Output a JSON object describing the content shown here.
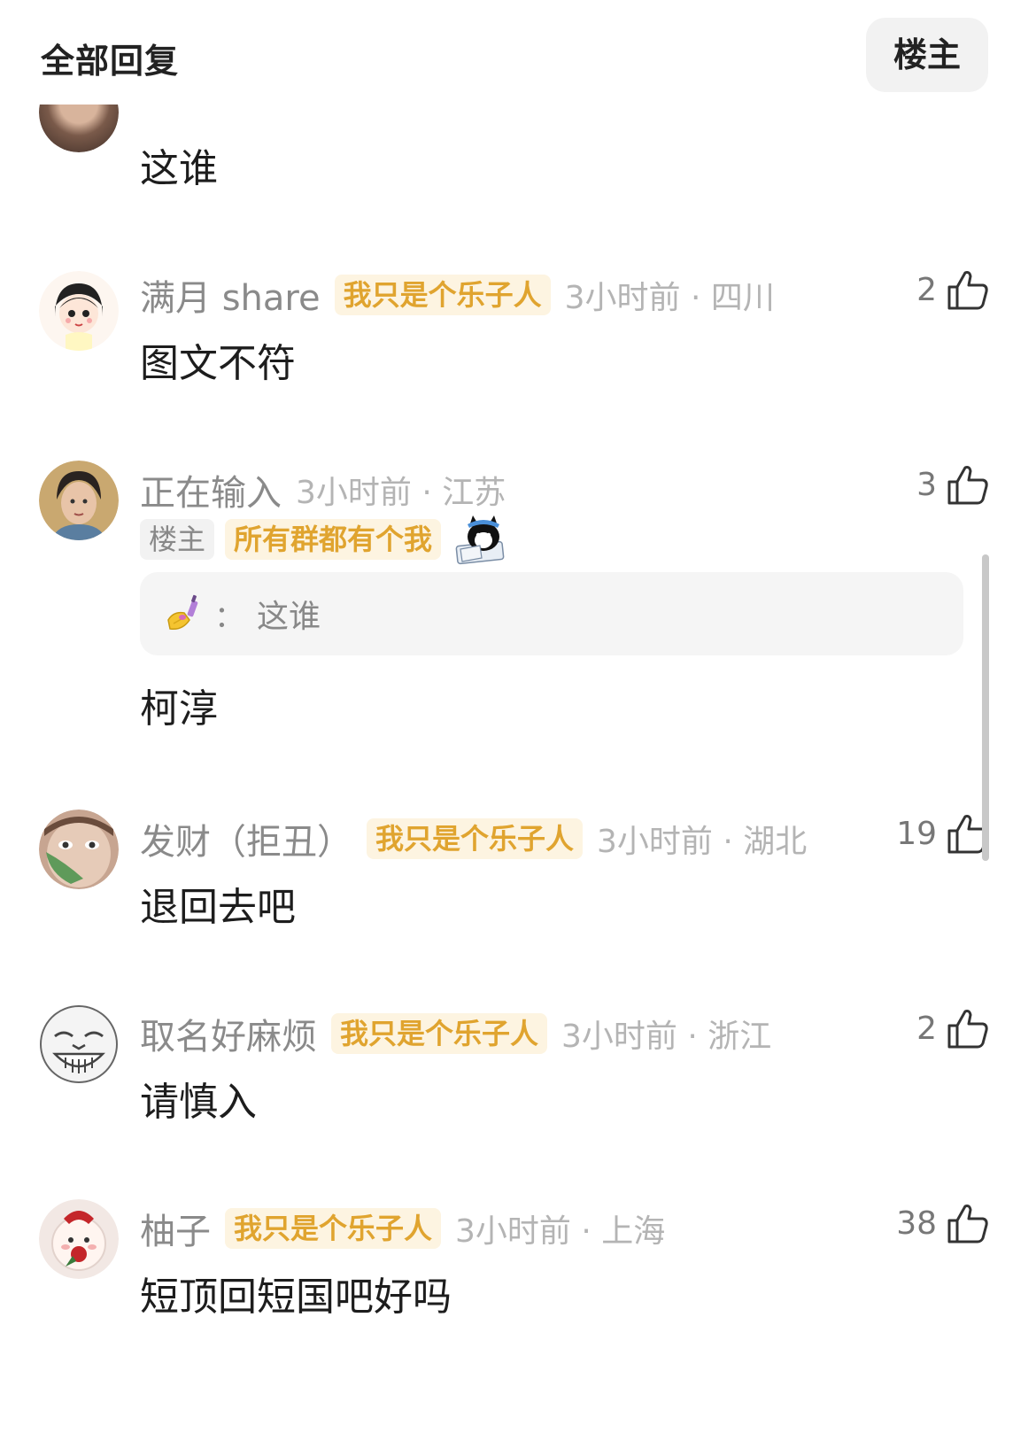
{
  "header": {
    "title": "全部回复",
    "filter_label": "楼主"
  },
  "partial_comment": {
    "content": "这谁"
  },
  "comments": [
    {
      "username": "满月 share",
      "badge": "我只是个乐子人",
      "time_location": "3小时前 · 四川",
      "likes": "2",
      "content": "图文不符"
    },
    {
      "username": "正在输入",
      "time_location": "3小时前 · 江苏",
      "likes": "3",
      "owner_tag": "楼主",
      "group_tag": "所有群都有个我",
      "quote_text": "这谁",
      "quote_colon": "：",
      "content": "柯淳"
    },
    {
      "username": "发财（拒丑）",
      "badge": "我只是个乐子人",
      "time_location": "3小时前 · 湖北",
      "likes": "19",
      "content": "退回去吧"
    },
    {
      "username": "取名好麻烦",
      "badge": "我只是个乐子人",
      "time_location": "3小时前 · 浙江",
      "likes": "2",
      "content": "请慎入"
    },
    {
      "username": "柚子",
      "badge": "我只是个乐子人",
      "time_location": "3小时前 · 上海",
      "likes": "38",
      "content": "短顶回短国吧好吗"
    }
  ],
  "icons": {
    "like": "thumbs-up-icon",
    "quote_emoji": "nail-polish-icon",
    "sticker": "cat-sticker-icon"
  }
}
